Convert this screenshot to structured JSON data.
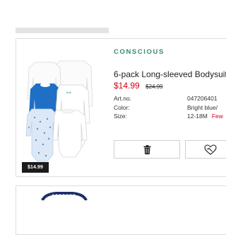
{
  "product": {
    "brand": "CONSCIOUS",
    "title": "6-pack Long-sleeved Bodysuit",
    "price_current": "$14.99",
    "price_old": "$24.99",
    "price_chip": "$14.99",
    "specs": [
      {
        "label": "Art.no.",
        "value": "047206401"
      },
      {
        "label": "Color:",
        "value": "Bright blue/"
      },
      {
        "label": "Size:",
        "value": "12-18M",
        "note": "Few"
      }
    ]
  },
  "icons": {
    "delete": "trash-icon",
    "favorite": "heart-broken-icon"
  },
  "colors": {
    "brand_green": "#3a8c6e",
    "sale_red": "#d6001c",
    "price_chip_bg": "#1b1b1b",
    "bodysuit_blue": "#1f6fc4"
  }
}
